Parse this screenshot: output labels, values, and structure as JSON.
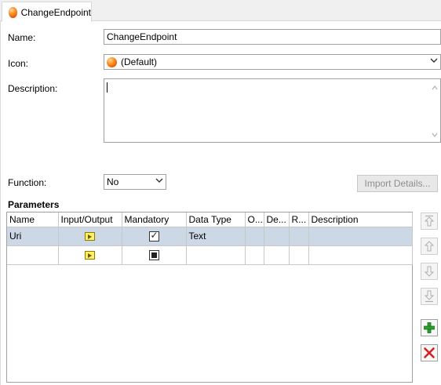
{
  "tab": {
    "label": "ChangeEndpoint"
  },
  "form": {
    "name_label": "Name:",
    "name_value": "ChangeEndpoint",
    "icon_label": "Icon:",
    "icon_value": "(Default)",
    "description_label": "Description:",
    "description_value": "",
    "function_label": "Function:",
    "function_value": "No",
    "import_details_label": "Import Details..."
  },
  "parameters": {
    "title": "Parameters",
    "columns": [
      "Name",
      "Input/Output",
      "Mandatory",
      "Data Type",
      "O...",
      "De...",
      "R...",
      "Description"
    ],
    "rows": [
      {
        "name": "Uri",
        "io": "input",
        "mandatory": "checked",
        "data_type": "Text",
        "o": "",
        "de": "",
        "r": "",
        "description": ""
      },
      {
        "name": "",
        "io": "input",
        "mandatory": "indeterminate",
        "data_type": "",
        "o": "",
        "de": "",
        "r": "",
        "description": ""
      }
    ]
  },
  "side_buttons": [
    "move-top-icon",
    "move-up-icon",
    "move-down-icon",
    "move-bottom-icon",
    "add-icon",
    "delete-icon"
  ],
  "colors": {
    "selected_row": "#cdd8e6",
    "add_green": "#2a9d2a",
    "delete_red": "#d62020",
    "orb": "#ff9a2e"
  }
}
